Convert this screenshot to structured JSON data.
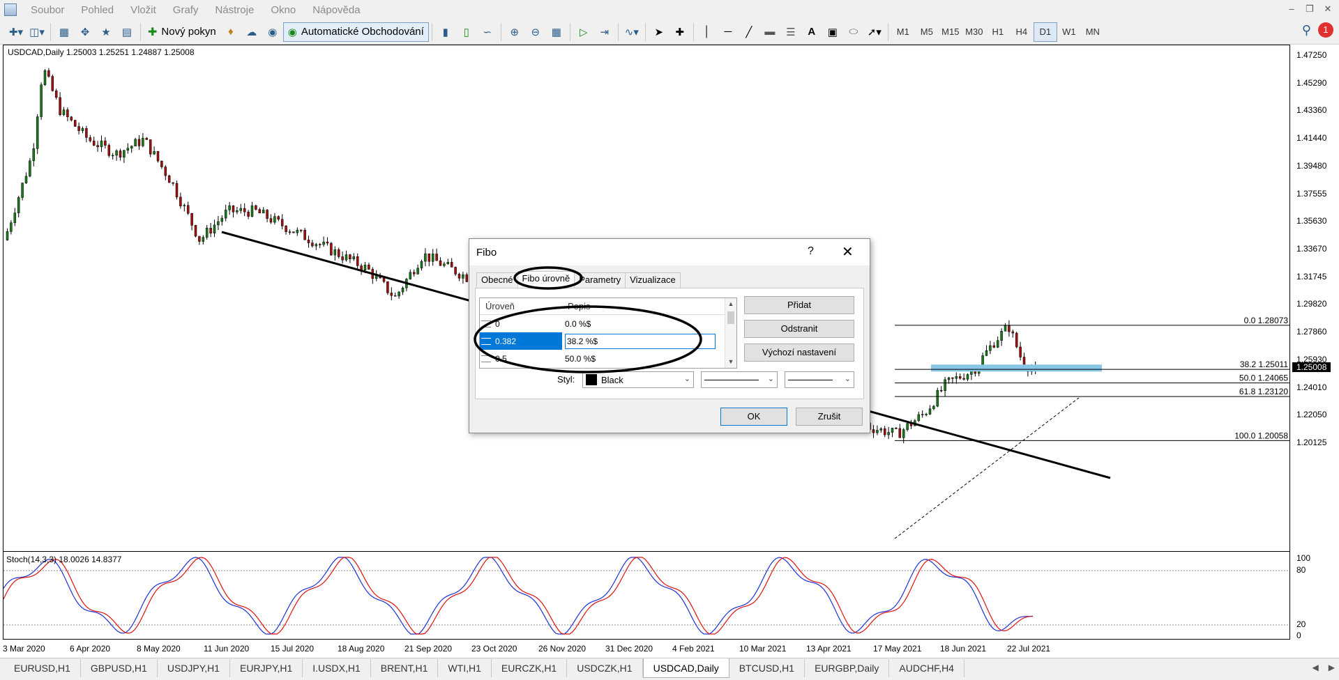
{
  "menu": [
    "Soubor",
    "Pohled",
    "Vložit",
    "Grafy",
    "Nástroje",
    "Okno",
    "Nápověda"
  ],
  "toolbar": {
    "new_order_label": "Nový pokyn",
    "auto_trading_label": "Automatické Obchodování",
    "timeframes": [
      "M1",
      "M5",
      "M15",
      "M30",
      "H1",
      "H4",
      "D1",
      "W1",
      "MN"
    ],
    "active_timeframe": "D1",
    "notification_count": "1"
  },
  "chart": {
    "info": "USDCAD,Daily  1.25003 1.25251 1.24887 1.25008",
    "price_labels": [
      "1.47250",
      "1.45290",
      "1.43360",
      "1.41440",
      "1.39480",
      "1.37555",
      "1.35630",
      "1.33670",
      "1.31745",
      "1.29820",
      "1.27860",
      "1.25930",
      "1.24010",
      "1.22050",
      "1.20125"
    ],
    "current_price": "1.25008",
    "fibo_levels": [
      {
        "label": "0.0 1.28073",
        "price": 1.28073
      },
      {
        "label": "38.2 1.25011",
        "price": 1.25011
      },
      {
        "label": "50.0 1.24065",
        "price": 1.24065
      },
      {
        "label": "61.8 1.23120",
        "price": 1.2312
      },
      {
        "label": "100.0 1.20058",
        "price": 1.20058
      }
    ],
    "time_labels": [
      "3 Mar 2020",
      "6 Apr 2020",
      "8 May 2020",
      "11 Jun 2020",
      "15 Jul 2020",
      "18 Aug 2020",
      "21 Sep 2020",
      "23 Oct 2020",
      "26 Nov 2020",
      "31 Dec 2020",
      "4 Feb 2021",
      "10 Mar 2021",
      "13 Apr 2021",
      "17 May 2021",
      "18 Jun 2021",
      "22 Jul 2021"
    ]
  },
  "indicator": {
    "info": "Stoch(14,3,3) 18.0026 14.8377",
    "levels": [
      "100",
      "80",
      "20",
      "0"
    ]
  },
  "dialog": {
    "title": "Fibo",
    "help": "?",
    "tabs": [
      "Obecné",
      "Fibo úrovně",
      "Parametry",
      "Vizualizace"
    ],
    "active_tab": "Fibo úrovně",
    "col_level": "Úroveň",
    "col_desc": "Popis",
    "rows": [
      {
        "level": "0",
        "desc": "0.0 %$"
      },
      {
        "level": "0.382",
        "desc": "38.2 %$"
      },
      {
        "level": "0.5",
        "desc": "50.0 %$"
      }
    ],
    "btn_add": "Přidat",
    "btn_remove": "Odstranit",
    "btn_default": "Výchozí nastavení",
    "style_label": "Styl:",
    "style_color": "Black",
    "btn_ok": "OK",
    "btn_cancel": "Zrušit"
  },
  "tabs": [
    "EURUSD,H1",
    "GBPUSD,H1",
    "USDJPY,H1",
    "EURJPY,H1",
    "I.USDX,H1",
    "BRENT,H1",
    "WTI,H1",
    "EURCZK,H1",
    "USDCZK,H1",
    "USDCAD,Daily",
    "BTCUSD,H1",
    "EURGBP,Daily",
    "AUDCHF,H4"
  ],
  "active_tab": "USDCAD,Daily",
  "colors": {
    "stoch_main": "#1f2fd6",
    "stoch_signal": "#e01010",
    "highlight": "#87c6e6",
    "candle_up": "#1a7a1a",
    "candle_down": "#a01010"
  }
}
